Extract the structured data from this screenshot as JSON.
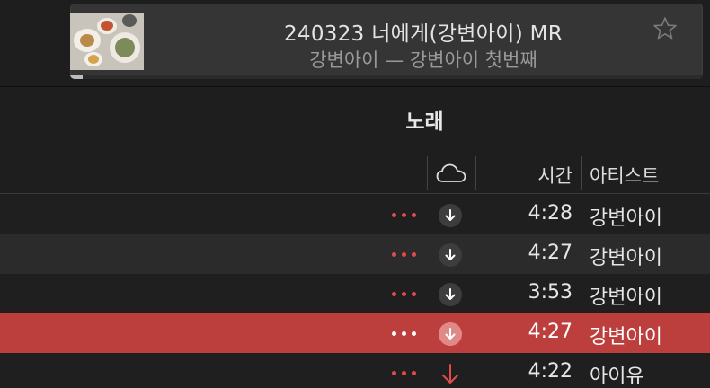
{
  "now_playing": {
    "title": "240323 너에게(강변아이) MR",
    "subtitle": "강변아이 — 강변아이 첫번째",
    "progress": 0.02,
    "starred": false
  },
  "table": {
    "section_title": "노래",
    "columns": {
      "cloud_icon": "cloud-icon",
      "time": "시간",
      "artist": "아티스트"
    },
    "rows": [
      {
        "time": "4:28",
        "artist": "강변아이",
        "status": "download",
        "selected": false
      },
      {
        "time": "4:27",
        "artist": "강변아이",
        "status": "download",
        "selected": false
      },
      {
        "time": "3:53",
        "artist": "강변아이",
        "status": "download",
        "selected": false
      },
      {
        "time": "4:27",
        "artist": "강변아이",
        "status": "download",
        "selected": true
      },
      {
        "time": "4:22",
        "artist": "아이유",
        "status": "downloading",
        "selected": false
      }
    ]
  },
  "colors": {
    "accent": "#e24b4b",
    "selection": "#bd3f3d",
    "background": "#1e1e1e"
  }
}
